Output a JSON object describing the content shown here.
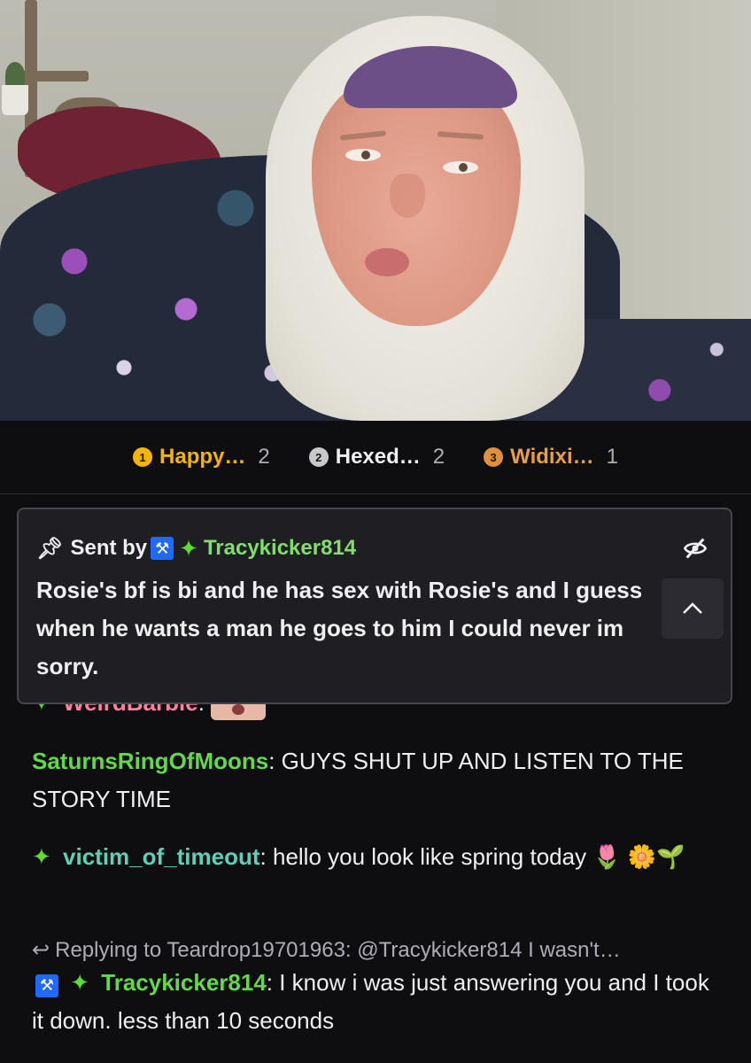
{
  "leaderboard": [
    {
      "rank": "1",
      "name": "Happy…",
      "count": "2",
      "color": "#f5b400",
      "name_color": "#f5b400"
    },
    {
      "rank": "2",
      "name": "Hexed…",
      "count": "2",
      "color": "#c8c8c8",
      "name_color": "#efeff1"
    },
    {
      "rank": "3",
      "name": "Widixi…",
      "count": "1",
      "color": "#e0913a",
      "name_color": "#e8a03c"
    }
  ],
  "pinned": {
    "sent_by_label": "Sent by",
    "username": "Tracykicker814",
    "message": "Rosie's bf is bi and he has sex with Rosie's and I guess when he wants a man he goes to him I could never im sorry.",
    "icons": [
      "pin-icon",
      "moderator-badge-icon",
      "sparkle-badge-icon",
      "hide-eye-slash-icon",
      "chevron-up-icon"
    ]
  },
  "chat": {
    "partial": {
      "username": "WeirdBarbie",
      "suffix": ":"
    },
    "messages": [
      {
        "username": "SaturnsRingOfMoons",
        "sep": ":",
        "text": " GUYS SHUT UP AND LISTEN TO THE STORY TIME"
      },
      {
        "username": "victim_of_timeout",
        "sep": ":",
        "text": " hello you look like spring today 🌷 🌼🌱"
      },
      {
        "username": "Tracykicker814",
        "sep": ":",
        "text": " I know i was just answering you and I took it down. less than 10 seconds"
      }
    ],
    "reply": {
      "label": "Replying to Teardrop19701963: @Tracykicker814 I wasn't…"
    }
  },
  "colors": {
    "background": "#0e0e10",
    "pinned_bg": "#1f1f23",
    "mod_blue": "#1f69ff",
    "sparkle_green": "#5ede2c"
  }
}
